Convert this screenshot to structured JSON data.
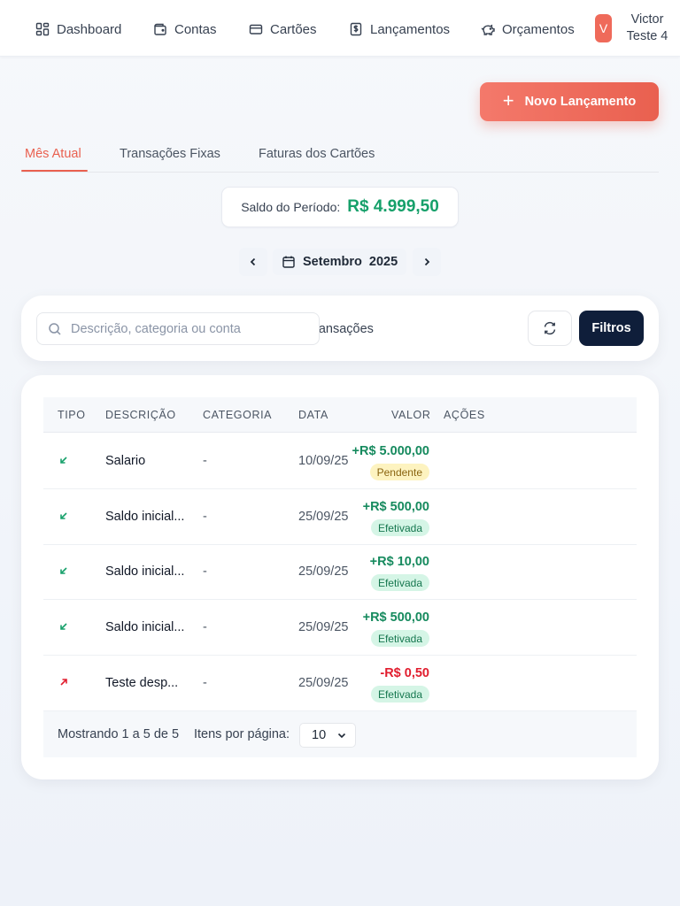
{
  "nav": {
    "items": [
      {
        "label": "Dashboard",
        "icon": "dashboard-icon"
      },
      {
        "label": "Contas",
        "icon": "wallet-icon"
      },
      {
        "label": "Cartões",
        "icon": "credit-card-icon"
      },
      {
        "label": "Lançamentos",
        "icon": "dollar-receipt-icon"
      },
      {
        "label": "Orçamentos",
        "icon": "piggy-bank-icon"
      }
    ],
    "user": {
      "initial": "V",
      "name_line1": "Victor",
      "name_line2": "Teste 4"
    }
  },
  "actions": {
    "new_entry_label": "Novo Lançamento"
  },
  "tabs": [
    {
      "label": "Mês Atual",
      "active": true
    },
    {
      "label": "Transações Fixas",
      "active": false
    },
    {
      "label": "Faturas dos Cartões",
      "active": false
    }
  ],
  "balance": {
    "label": "Saldo do Período:",
    "value": "R$ 4.999,50"
  },
  "period": {
    "month": "Setembro",
    "year": "2025"
  },
  "search": {
    "placeholder": "Descrição, categoria ou conta",
    "partial_background_text": "ransações",
    "filters_label": "Filtros"
  },
  "table": {
    "headers": {
      "tipo": "TIPO",
      "descricao": "DESCRIÇÃO",
      "categoria": "CATEGORIA",
      "data": "DATA",
      "valor": "VALOR",
      "acoes": "AÇÕES"
    },
    "rows": [
      {
        "type": "income",
        "description": "Salario",
        "category": "-",
        "date": "10/09/25",
        "amount": "+R$ 5.000,00",
        "status": "Pendente"
      },
      {
        "type": "income",
        "description": "Saldo inicial...",
        "category": "-",
        "date": "25/09/25",
        "amount": "+R$ 500,00",
        "status": "Efetivada"
      },
      {
        "type": "income",
        "description": "Saldo inicial...",
        "category": "-",
        "date": "25/09/25",
        "amount": "+R$ 10,00",
        "status": "Efetivada"
      },
      {
        "type": "income",
        "description": "Saldo inicial...",
        "category": "-",
        "date": "25/09/25",
        "amount": "+R$ 500,00",
        "status": "Efetivada"
      },
      {
        "type": "expense",
        "description": "Teste desp...",
        "category": "-",
        "date": "25/09/25",
        "amount": "-R$ 0,50",
        "status": "Efetivada"
      }
    ],
    "footer": {
      "showing": "Mostrando 1 a 5 de 5",
      "per_page_label": "Itens por página:",
      "per_page_value": "10"
    }
  },
  "colors": {
    "accent": "#e9604f",
    "positive": "#168a5e",
    "negative": "#e11d2e",
    "dark_button": "#0f1e3a",
    "pending_badge": "#fdf3c0",
    "done_badge": "#d5f5e6"
  }
}
